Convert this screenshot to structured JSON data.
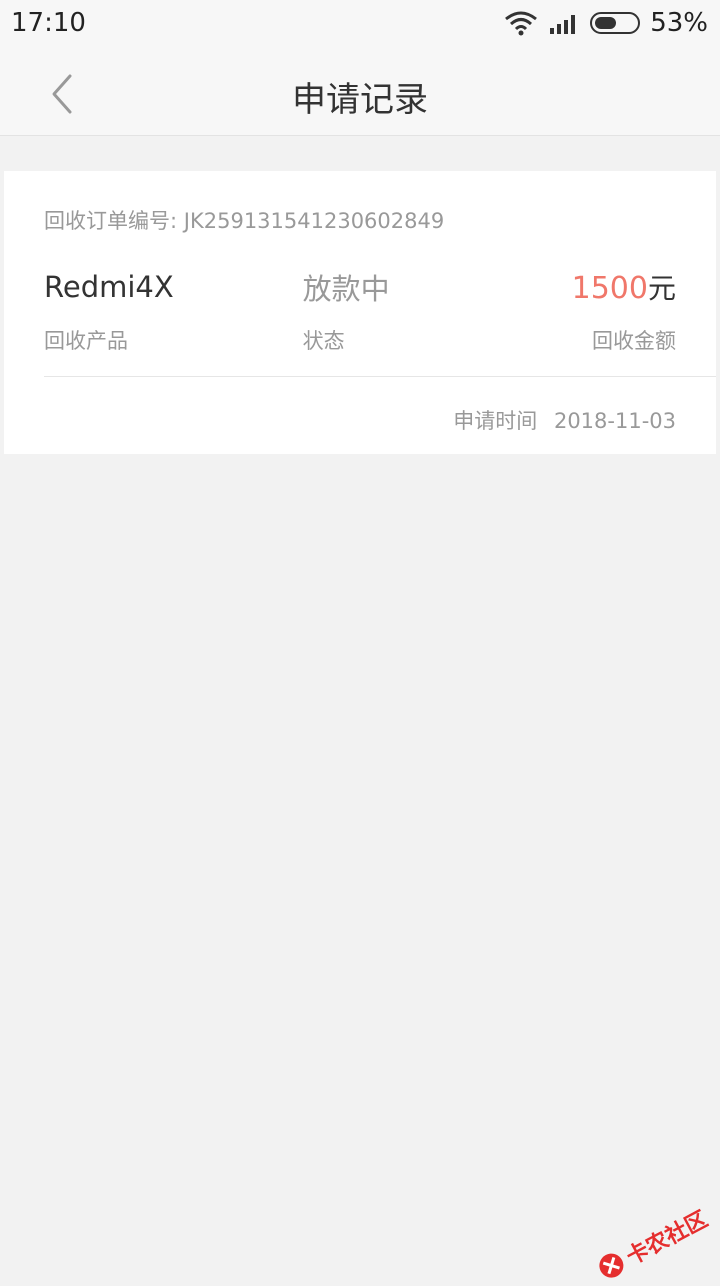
{
  "status_bar": {
    "time": "17:10",
    "battery_percent": "53%",
    "battery_level": 0.53
  },
  "header": {
    "title": "申请记录"
  },
  "record": {
    "order_label": "回收订单编号:",
    "order_number": "JK259131541230602849",
    "product_value": "Redmi4X",
    "status_value": "放款中",
    "amount_value": "1500",
    "amount_unit": "元",
    "product_label": "回收产品",
    "status_label": "状态",
    "amount_label": "回收金额",
    "apply_time_label": "申请时间",
    "apply_time_value": "2018-11-03"
  },
  "watermark": {
    "text": "卡农社区"
  },
  "colors": {
    "accent": "#f0776a",
    "background": "#f2f2f2"
  }
}
